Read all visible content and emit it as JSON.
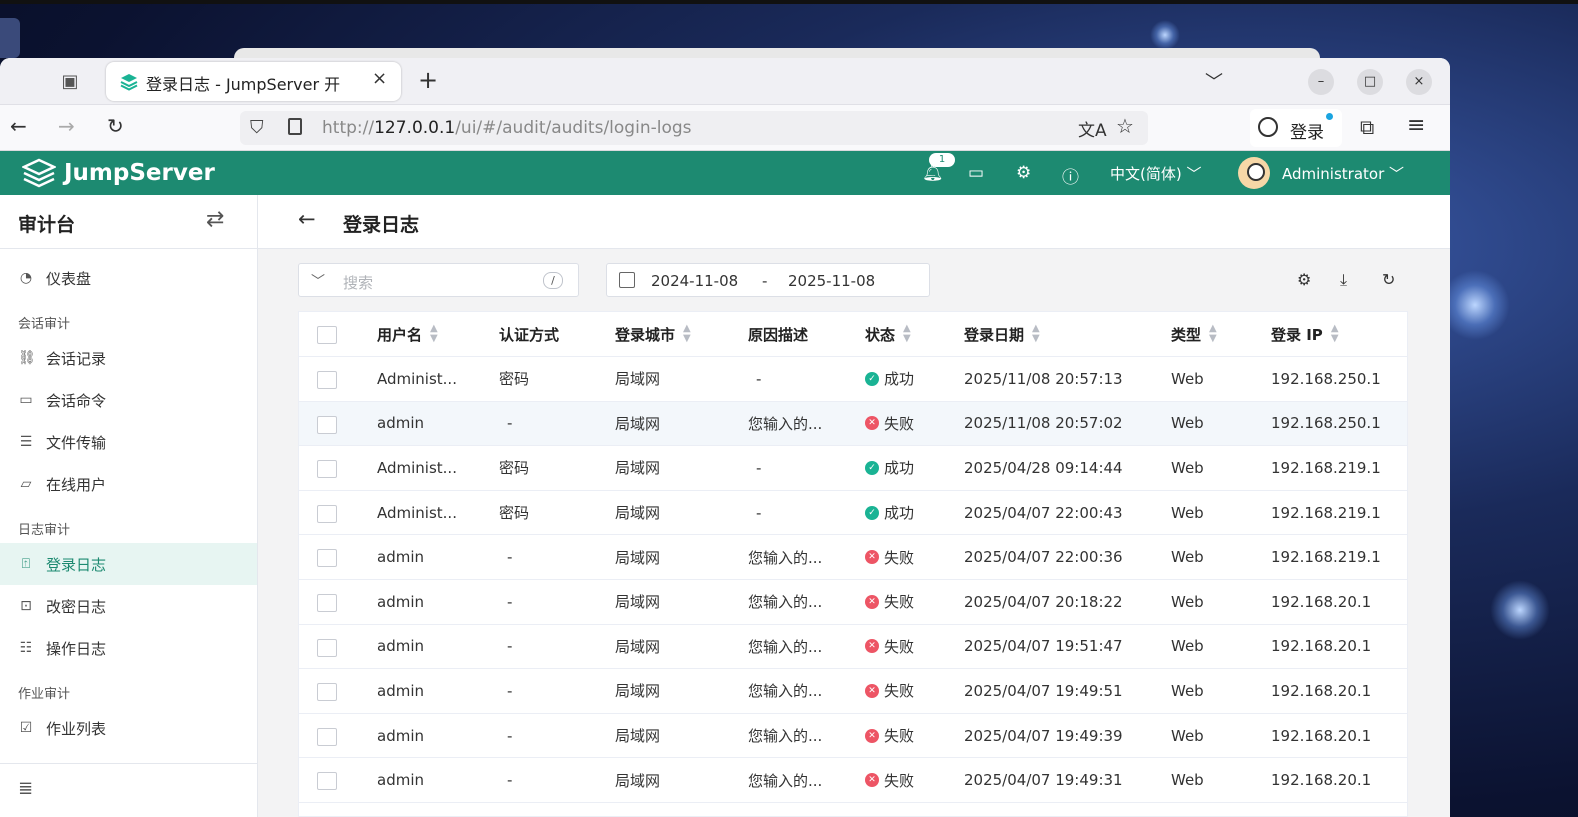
{
  "browser": {
    "tab_title": "登录日志 - JumpServer 开",
    "tab_close": "×",
    "new_tab": "+",
    "url_host": "127.0.0.1",
    "url_prefix": "http://",
    "url_path": "/ui/#/audit/audits/login-logs",
    "account_label": "登录",
    "win_min": "–",
    "win_max": "□",
    "win_close": "×"
  },
  "app": {
    "logo": "JumpServer",
    "notification_count": "1",
    "language": "中文(简体) ﹀",
    "user": "Administrator ﹀"
  },
  "sidebar": {
    "title": "审计台",
    "items_top": [
      {
        "label": "仪表盘",
        "icon": "dashboard-icon"
      }
    ],
    "groups": [
      {
        "label": "会话审计",
        "items": [
          {
            "label": "会话记录",
            "icon": "link-icon"
          },
          {
            "label": "会话命令",
            "icon": "terminal-icon"
          },
          {
            "label": "文件传输",
            "icon": "file-icon"
          },
          {
            "label": "在线用户",
            "icon": "monitor-icon"
          }
        ]
      },
      {
        "label": "日志审计",
        "items": [
          {
            "label": "登录日志",
            "icon": "login-icon",
            "active": true
          },
          {
            "label": "改密日志",
            "icon": "lock-icon"
          },
          {
            "label": "操作日志",
            "icon": "list-icon"
          }
        ]
      },
      {
        "label": "作业审计",
        "items": [
          {
            "label": "作业列表",
            "icon": "checklist-icon"
          }
        ]
      }
    ]
  },
  "page": {
    "title": "登录日志",
    "search_placeholder": "搜索",
    "search_shortcut": "/",
    "date_from": "2024-11-08",
    "date_sep": "-",
    "date_to": "2025-11-08"
  },
  "table": {
    "columns": [
      "用户名",
      "认证方式",
      "登录城市",
      "原因描述",
      "状态",
      "登录日期",
      "类型",
      "登录 IP"
    ],
    "rows": [
      {
        "user": "Administ...",
        "auth": "密码",
        "city": "局域网",
        "reason": "-",
        "status": "成功",
        "ok": true,
        "date": "2025/11/08 20:57:13",
        "type": "Web",
        "ip": "192.168.250.1"
      },
      {
        "user": "admin",
        "auth": "-",
        "city": "局域网",
        "reason": "您输入的...",
        "status": "失败",
        "ok": false,
        "date": "2025/11/08 20:57:02",
        "type": "Web",
        "ip": "192.168.250.1"
      },
      {
        "user": "Administ...",
        "auth": "密码",
        "city": "局域网",
        "reason": "-",
        "status": "成功",
        "ok": true,
        "date": "2025/04/28 09:14:44",
        "type": "Web",
        "ip": "192.168.219.1"
      },
      {
        "user": "Administ...",
        "auth": "密码",
        "city": "局域网",
        "reason": "-",
        "status": "成功",
        "ok": true,
        "date": "2025/04/07 22:00:43",
        "type": "Web",
        "ip": "192.168.219.1"
      },
      {
        "user": "admin",
        "auth": "-",
        "city": "局域网",
        "reason": "您输入的...",
        "status": "失败",
        "ok": false,
        "date": "2025/04/07 22:00:36",
        "type": "Web",
        "ip": "192.168.219.1"
      },
      {
        "user": "admin",
        "auth": "-",
        "city": "局域网",
        "reason": "您输入的...",
        "status": "失败",
        "ok": false,
        "date": "2025/04/07 20:18:22",
        "type": "Web",
        "ip": "192.168.20.1"
      },
      {
        "user": "admin",
        "auth": "-",
        "city": "局域网",
        "reason": "您输入的...",
        "status": "失败",
        "ok": false,
        "date": "2025/04/07 19:51:47",
        "type": "Web",
        "ip": "192.168.20.1"
      },
      {
        "user": "admin",
        "auth": "-",
        "city": "局域网",
        "reason": "您输入的...",
        "status": "失败",
        "ok": false,
        "date": "2025/04/07 19:49:51",
        "type": "Web",
        "ip": "192.168.20.1"
      },
      {
        "user": "admin",
        "auth": "-",
        "city": "局域网",
        "reason": "您输入的...",
        "status": "失败",
        "ok": false,
        "date": "2025/04/07 19:49:39",
        "type": "Web",
        "ip": "192.168.20.1"
      },
      {
        "user": "admin",
        "auth": "-",
        "city": "局域网",
        "reason": "您输入的...",
        "status": "失败",
        "ok": false,
        "date": "2025/04/07 19:49:31",
        "type": "Web",
        "ip": "192.168.20.1"
      }
    ]
  },
  "colors": {
    "brand": "#1d8a71",
    "success": "#1ab394",
    "fail": "#ed5565"
  }
}
